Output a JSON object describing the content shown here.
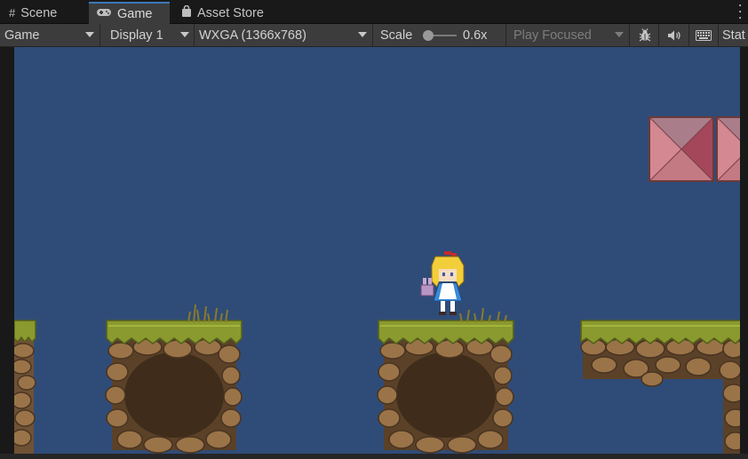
{
  "tabs": [
    {
      "label": "Scene",
      "icon": "scene-grid-icon",
      "active": false
    },
    {
      "label": "Game",
      "icon": "gamepad-icon",
      "active": true
    },
    {
      "label": "Asset Store",
      "icon": "shopping-bag-icon",
      "active": false
    }
  ],
  "toolbar": {
    "view_mode": "Game",
    "display": "Display 1",
    "resolution": "WXGA (1366x768)",
    "scale_label": "Scale",
    "scale_value": "0.6x",
    "scale_fraction": 0.0,
    "play_mode": "Play Focused",
    "stats_label": "Stat",
    "icons": [
      "bug-icon",
      "audio-mute-icon",
      "keyboard-icon"
    ]
  },
  "colors": {
    "sky": "#2f4c78",
    "editor_bg": "#191919",
    "toolbar_bg": "#3c3c3c",
    "grass": "#8a9a2e",
    "dirt": "#8b6a42",
    "crate": "#c26b7a",
    "active_tab_accent": "#3a79bb"
  }
}
